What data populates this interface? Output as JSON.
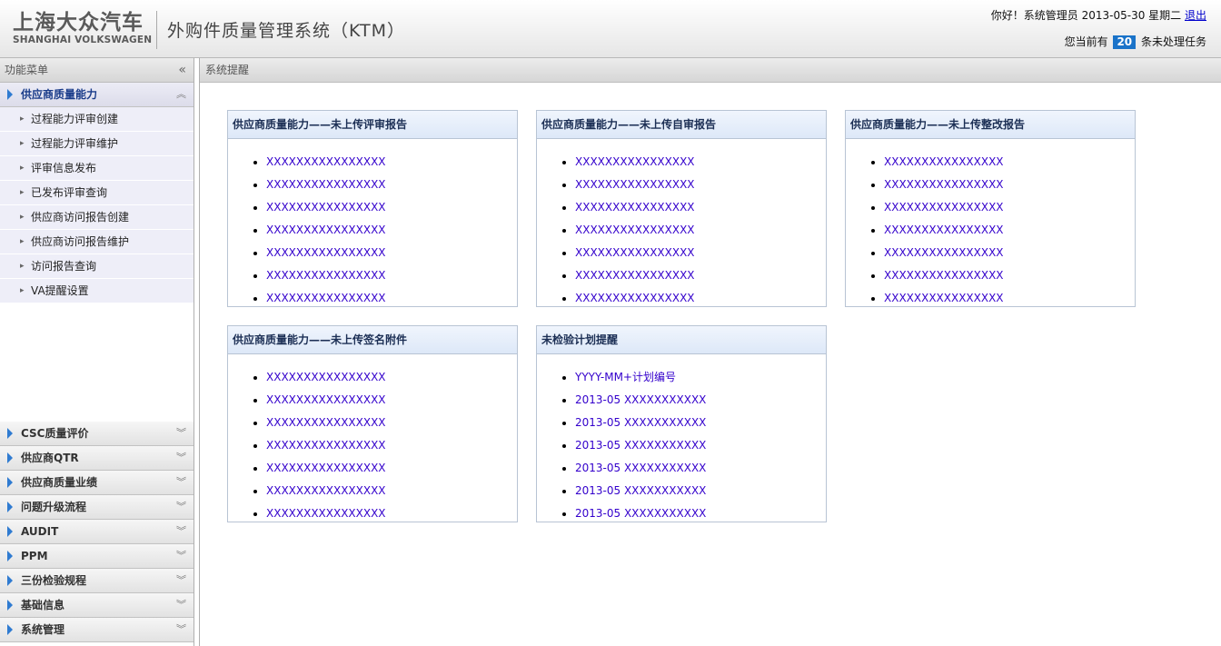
{
  "header": {
    "logo_cn": "上海大众汽车",
    "logo_en": "SHANGHAI VOLKSWAGEN",
    "system_title": "外购件质量管理系统（KTM）",
    "greeting": "你好！系统管理员 2013-05-30 星期二",
    "logout": "退出",
    "tasks_prefix": "您当前有",
    "task_count": "20",
    "tasks_suffix": "条未处理任务"
  },
  "sidebar": {
    "title": "功能菜单",
    "collapse_icon": "«",
    "active_group": "供应商质量能力",
    "sub_items": [
      "过程能力评审创建",
      "过程能力评审维护",
      "评审信息发布",
      "已发布评审查询",
      "供应商访问报告创建",
      "供应商访问报告维护",
      "访问报告查询",
      "VA提醒设置"
    ],
    "groups": [
      "CSC质量评价",
      "供应商QTR",
      "供应商质量业绩",
      "问题升级流程",
      "AUDIT",
      "PPM",
      "三份检验规程",
      "基础信息",
      "系统管理"
    ]
  },
  "main": {
    "title": "系统提醒",
    "panels": [
      {
        "title": "供应商质量能力——未上传评审报告",
        "items": [
          "XXXXXXXXXXXXXXXX",
          "XXXXXXXXXXXXXXXX",
          "XXXXXXXXXXXXXXXX",
          "XXXXXXXXXXXXXXXX",
          "XXXXXXXXXXXXXXXX",
          "XXXXXXXXXXXXXXXX",
          "XXXXXXXXXXXXXXXX"
        ]
      },
      {
        "title": "供应商质量能力——未上传自审报告",
        "items": [
          "XXXXXXXXXXXXXXXX",
          "XXXXXXXXXXXXXXXX",
          "XXXXXXXXXXXXXXXX",
          "XXXXXXXXXXXXXXXX",
          "XXXXXXXXXXXXXXXX",
          "XXXXXXXXXXXXXXXX",
          "XXXXXXXXXXXXXXXX"
        ]
      },
      {
        "title": "供应商质量能力——未上传整改报告",
        "items": [
          "XXXXXXXXXXXXXXXX",
          "XXXXXXXXXXXXXXXX",
          "XXXXXXXXXXXXXXXX",
          "XXXXXXXXXXXXXXXX",
          "XXXXXXXXXXXXXXXX",
          "XXXXXXXXXXXXXXXX",
          "XXXXXXXXXXXXXXXX"
        ]
      },
      {
        "title": "供应商质量能力——未上传签名附件",
        "items": [
          "XXXXXXXXXXXXXXXX",
          "XXXXXXXXXXXXXXXX",
          "XXXXXXXXXXXXXXXX",
          "XXXXXXXXXXXXXXXX",
          "XXXXXXXXXXXXXXXX",
          "XXXXXXXXXXXXXXXX",
          "XXXXXXXXXXXXXXXX"
        ]
      },
      {
        "title": "未检验计划提醒",
        "items": [
          "YYYY-MM+计划编号",
          "2013-05 XXXXXXXXXXX",
          "2013-05 XXXXXXXXXXX",
          "2013-05 XXXXXXXXXXX",
          "2013-05 XXXXXXXXXXX",
          "2013-05 XXXXXXXXXXX",
          "2013-05 XXXXXXXXXXX"
        ]
      }
    ]
  },
  "colors": {
    "accent": "#2f7bd1",
    "link": "#3300cc",
    "task_badge": "#1a73c9"
  }
}
